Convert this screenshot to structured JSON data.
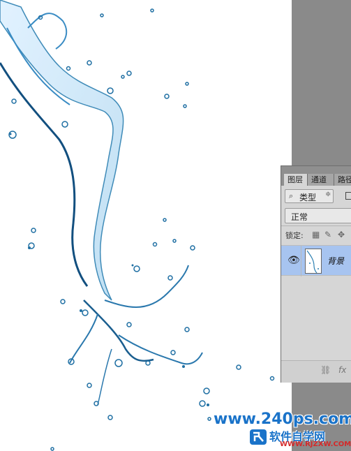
{
  "layers_panel": {
    "tabs": [
      {
        "label": "图层",
        "active": true
      },
      {
        "label": "通道",
        "active": false
      },
      {
        "label": "路径",
        "active": false
      }
    ],
    "filter": {
      "search_icon": "search-icon",
      "label": "类型",
      "arrows": "≑"
    },
    "blend_mode": "正常",
    "lock_label": "锁定:",
    "layer": {
      "name": "背景",
      "visible": true,
      "selected": true
    },
    "footer_icons": [
      "link-icon",
      "fx-icon"
    ],
    "footer_fx": "fx"
  },
  "watermark": {
    "domain": "www.240ps.com",
    "cn_text": "软件自学网",
    "site": "WWW.RJZXW.COM"
  },
  "colors": {
    "workspace": "#8a8a8a",
    "panel": "#d6d6d6",
    "selected_layer": "#a7c4f0",
    "water_blue": "#1f6fa3",
    "watermark_blue": "#1a73c9"
  }
}
